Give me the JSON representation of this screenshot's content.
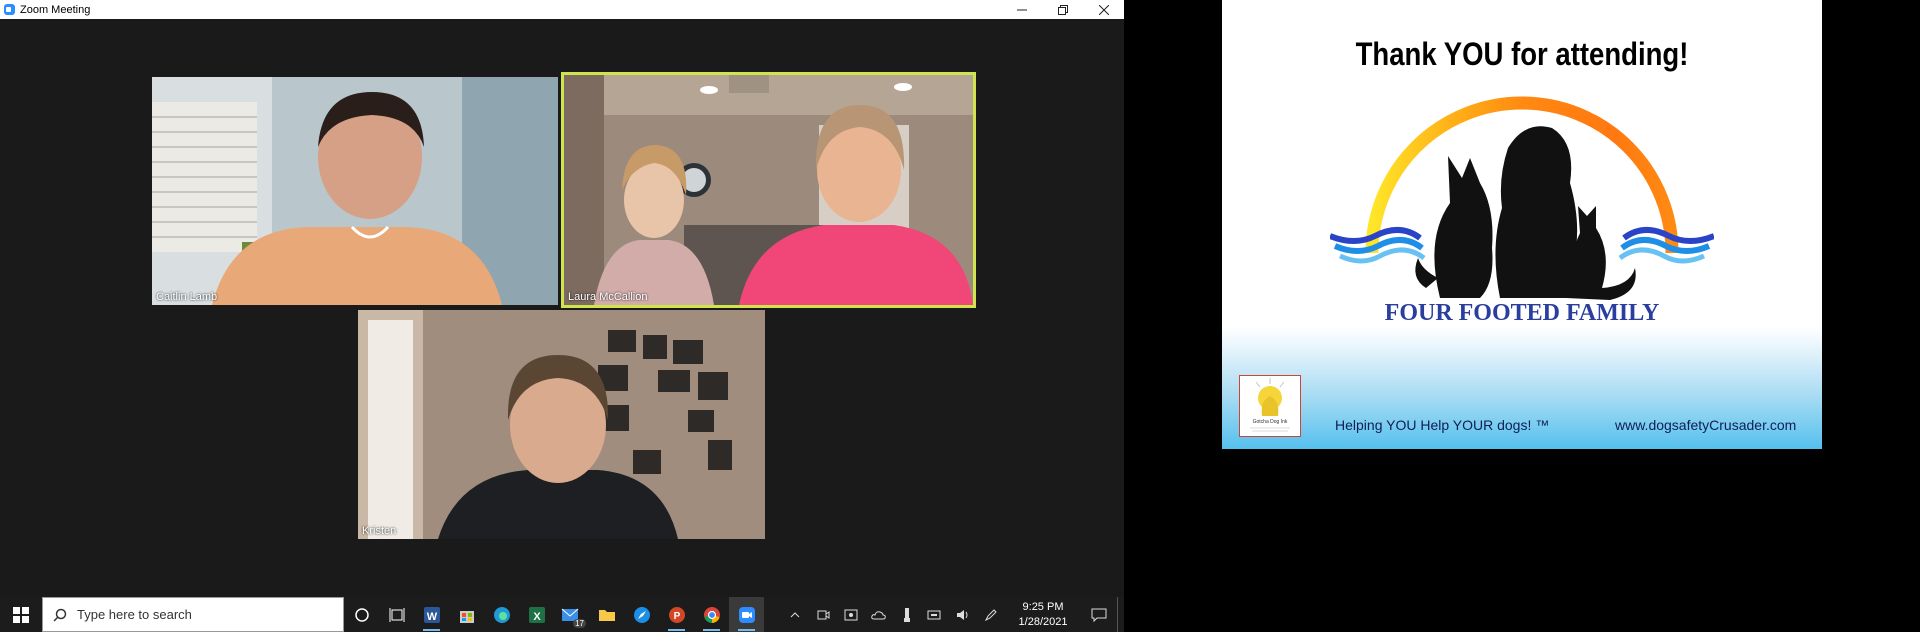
{
  "window": {
    "title": "Zoom Meeting"
  },
  "participants": [
    {
      "name": "Caitlin Lamb"
    },
    {
      "name": "Laura McCallion"
    },
    {
      "name": "Kristen"
    }
  ],
  "taskbar": {
    "search_placeholder": "Type here to search",
    "mail_badge": "17",
    "time": "9:25 PM",
    "date": "1/28/2021"
  },
  "slide": {
    "title": "Thank YOU for attending!",
    "brand": "FOUR FOOTED FAMILY",
    "tagline": "Helping YOU Help YOUR dogs! ™",
    "website": "www.dogsafetyCrusader.com",
    "mini_logo_text": "Gotcha Dog Ink"
  },
  "colors": {
    "active_speaker_border": "#cfe44d",
    "brand_blue": "#2a3e9e",
    "zoom_blue": "#2d8cff"
  }
}
